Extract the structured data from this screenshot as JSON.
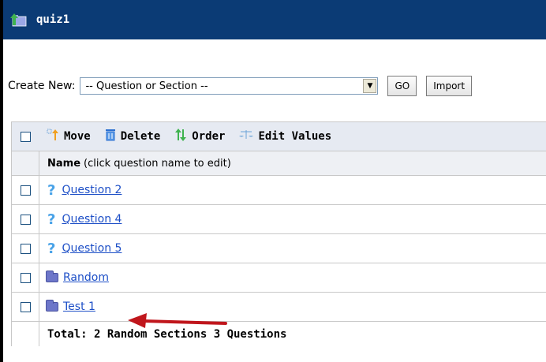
{
  "window": {
    "title": "quiz1"
  },
  "create": {
    "label": "Create New:",
    "selected": "-- Question or Section --",
    "go_label": "GO",
    "import_label": "Import"
  },
  "toolbar": {
    "move": "Move",
    "delete": "Delete",
    "order": "Order",
    "edit_values": "Edit Values"
  },
  "header": {
    "name_bold": "Name",
    "name_hint": "(click question name to edit)"
  },
  "items": [
    {
      "type": "question",
      "label": "Question 2"
    },
    {
      "type": "question",
      "label": "Question 4"
    },
    {
      "type": "question",
      "label": "Question 5"
    },
    {
      "type": "section",
      "label": "Random"
    },
    {
      "type": "section",
      "label": "Test 1"
    }
  ],
  "footer": {
    "total": "Total: 2 Random Sections  3 Questions"
  },
  "colors": {
    "titlebar": "#0b3b75",
    "link": "#1d4fc7",
    "annotation_arrow": "#c0161c"
  }
}
